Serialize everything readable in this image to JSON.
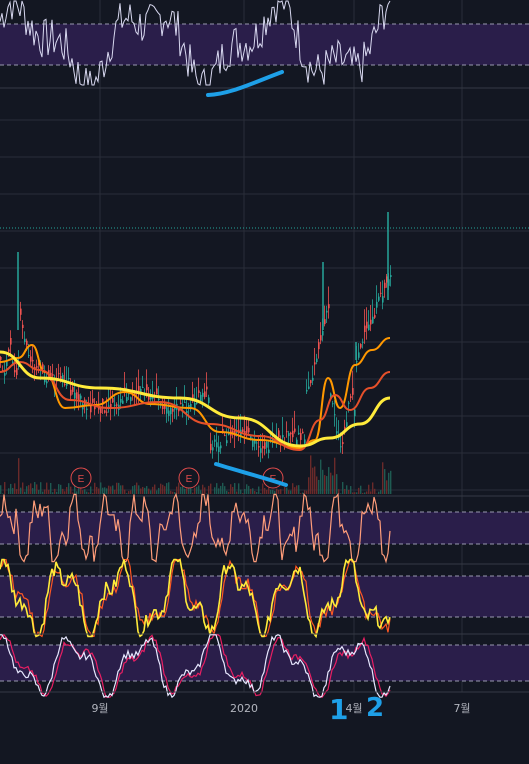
{
  "chart_data": {
    "type": "line",
    "title": "",
    "x_axis": {
      "ticks": [
        "9월",
        "2020",
        "4월",
        "7월"
      ]
    },
    "earnings_markers": [
      "E",
      "E",
      "E"
    ],
    "annotations": [
      "1",
      "2"
    ],
    "panels": [
      {
        "name": "top_oscillator",
        "series": [
          {
            "color": "#d8d8f0"
          }
        ],
        "band": [
          30,
          70
        ],
        "ylim": [
          0,
          100
        ]
      },
      {
        "name": "price",
        "series": [
          {
            "color": "#ff9800"
          },
          {
            "color": "#e6502a"
          },
          {
            "color": "#ffeb3b"
          }
        ],
        "candles_colors": {
          "up": "#26a69a",
          "down": "#ef5350"
        }
      },
      {
        "name": "osc1",
        "series": [
          {
            "color": "#ff9d7a"
          }
        ],
        "band": [
          20,
          80
        ],
        "ylim": [
          0,
          100
        ]
      },
      {
        "name": "osc2",
        "series": [
          {
            "color": "#ffeb3b"
          },
          {
            "color": "#ff5722"
          }
        ],
        "band": [
          20,
          80
        ],
        "ylim": [
          0,
          100
        ]
      },
      {
        "name": "osc3",
        "series": [
          {
            "color": "#e8e8ff"
          },
          {
            "color": "#e91e63"
          }
        ],
        "band": [
          20,
          80
        ],
        "ylim": [
          0,
          100
        ]
      }
    ]
  },
  "colors": {
    "background": "#131722",
    "band": "#2a1e4a",
    "grid": "#2a2e39",
    "annotation": "#1ea0e8"
  }
}
